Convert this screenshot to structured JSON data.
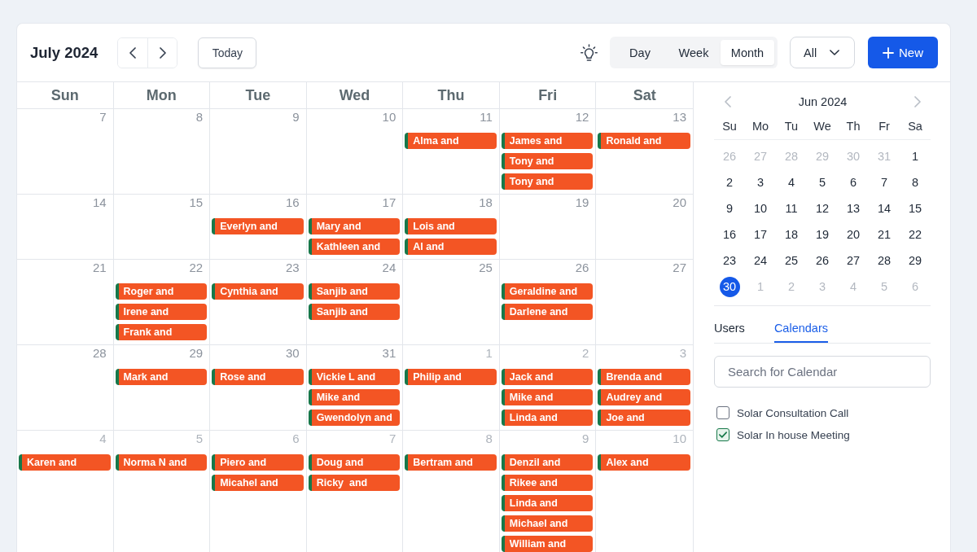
{
  "header": {
    "title": "July 2024",
    "today_button": "Today",
    "view_tabs": [
      {
        "label": "Day",
        "selected": false
      },
      {
        "label": "Week",
        "selected": false
      },
      {
        "label": "Month",
        "selected": true
      }
    ],
    "filter": {
      "value": "All"
    },
    "new_button": {
      "label": "New"
    }
  },
  "calendar": {
    "weekdays": [
      "Sun",
      "Mon",
      "Tue",
      "Wed",
      "Thu",
      "Fri",
      "Sat"
    ],
    "weeks": [
      {
        "days": [
          {
            "date": "7",
            "in_month": true
          },
          {
            "date": "8",
            "in_month": true
          },
          {
            "date": "9",
            "in_month": true
          },
          {
            "date": "10",
            "in_month": true
          },
          {
            "date": "11",
            "in_month": true,
            "events": [
              "Alma and"
            ]
          },
          {
            "date": "12",
            "in_month": true,
            "events": [
              "James and",
              "Tony and",
              "Tony and"
            ]
          },
          {
            "date": "13",
            "in_month": true,
            "events": [
              "Ronald and"
            ]
          }
        ]
      },
      {
        "days": [
          {
            "date": "14",
            "in_month": true
          },
          {
            "date": "15",
            "in_month": true
          },
          {
            "date": "16",
            "in_month": true,
            "events": [
              "Everlyn and"
            ]
          },
          {
            "date": "17",
            "in_month": true,
            "events": [
              "Mary and",
              "Kathleen and"
            ]
          },
          {
            "date": "18",
            "in_month": true,
            "events": [
              "Lois and",
              "Al and"
            ]
          },
          {
            "date": "19",
            "in_month": true
          },
          {
            "date": "20",
            "in_month": true
          }
        ]
      },
      {
        "days": [
          {
            "date": "21",
            "in_month": true
          },
          {
            "date": "22",
            "in_month": true,
            "events": [
              "Roger and",
              "Irene and",
              "Frank and"
            ]
          },
          {
            "date": "23",
            "in_month": true,
            "events": [
              "Cynthia and"
            ]
          },
          {
            "date": "24",
            "in_month": true,
            "events": [
              "Sanjib and",
              "Sanjib and"
            ]
          },
          {
            "date": "25",
            "in_month": true
          },
          {
            "date": "26",
            "in_month": true,
            "events": [
              "Geraldine and",
              "Darlene and"
            ]
          },
          {
            "date": "27",
            "in_month": true
          }
        ]
      },
      {
        "days": [
          {
            "date": "28",
            "in_month": true
          },
          {
            "date": "29",
            "in_month": true,
            "events": [
              "Mark and"
            ]
          },
          {
            "date": "30",
            "in_month": true,
            "events": [
              "Rose and"
            ]
          },
          {
            "date": "31",
            "in_month": true,
            "events": [
              "Vickie L and",
              "Mike and",
              "Gwendolyn and"
            ]
          },
          {
            "date": "1",
            "in_month": false,
            "events": [
              "Philip and"
            ]
          },
          {
            "date": "2",
            "in_month": false,
            "events": [
              "Jack and",
              "Mike and",
              "Linda and"
            ]
          },
          {
            "date": "3",
            "in_month": false,
            "events": [
              "Brenda and",
              "Audrey and",
              "Joe and"
            ]
          }
        ]
      },
      {
        "days": [
          {
            "date": "4",
            "in_month": false,
            "events": [
              "Karen and"
            ]
          },
          {
            "date": "5",
            "in_month": false,
            "events": [
              "Norma N and"
            ]
          },
          {
            "date": "6",
            "in_month": false,
            "events": [
              "Piero and",
              "Micahel and"
            ]
          },
          {
            "date": "7",
            "in_month": false,
            "events": [
              "Doug and",
              "Ricky  and"
            ]
          },
          {
            "date": "8",
            "in_month": false,
            "events": [
              "Bertram and"
            ]
          },
          {
            "date": "9",
            "in_month": false,
            "events": [
              "Denzil and",
              "Rikee and",
              "Linda and",
              "Michael and",
              "William and"
            ]
          },
          {
            "date": "10",
            "in_month": false,
            "events": [
              "Alex and"
            ]
          }
        ]
      }
    ]
  },
  "sidebar": {
    "mini_calendar": {
      "title": "Jun 2024",
      "weekdays": [
        "Su",
        "Mo",
        "Tu",
        "We",
        "Th",
        "Fr",
        "Sa"
      ],
      "weeks": [
        {
          "days": [
            {
              "date": "26",
              "in_month": false,
              "selected": false
            },
            {
              "date": "27",
              "in_month": false,
              "selected": false
            },
            {
              "date": "28",
              "in_month": false,
              "selected": false
            },
            {
              "date": "29",
              "in_month": false,
              "selected": false
            },
            {
              "date": "30",
              "in_month": false,
              "selected": false
            },
            {
              "date": "31",
              "in_month": false,
              "selected": false
            },
            {
              "date": "1",
              "in_month": true,
              "selected": false
            }
          ]
        },
        {
          "days": [
            {
              "date": "2",
              "in_month": true,
              "selected": false
            },
            {
              "date": "3",
              "in_month": true,
              "selected": false
            },
            {
              "date": "4",
              "in_month": true,
              "selected": false
            },
            {
              "date": "5",
              "in_month": true,
              "selected": false
            },
            {
              "date": "6",
              "in_month": true,
              "selected": false
            },
            {
              "date": "7",
              "in_month": true,
              "selected": false
            },
            {
              "date": "8",
              "in_month": true,
              "selected": false
            }
          ]
        },
        {
          "days": [
            {
              "date": "9",
              "in_month": true,
              "selected": false
            },
            {
              "date": "10",
              "in_month": true,
              "selected": false
            },
            {
              "date": "11",
              "in_month": true,
              "selected": false
            },
            {
              "date": "12",
              "in_month": true,
              "selected": false
            },
            {
              "date": "13",
              "in_month": true,
              "selected": false
            },
            {
              "date": "14",
              "in_month": true,
              "selected": false
            },
            {
              "date": "15",
              "in_month": true,
              "selected": false
            }
          ]
        },
        {
          "days": [
            {
              "date": "16",
              "in_month": true,
              "selected": false
            },
            {
              "date": "17",
              "in_month": true,
              "selected": false
            },
            {
              "date": "18",
              "in_month": true,
              "selected": false
            },
            {
              "date": "19",
              "in_month": true,
              "selected": false
            },
            {
              "date": "20",
              "in_month": true,
              "selected": false
            },
            {
              "date": "21",
              "in_month": true,
              "selected": false
            },
            {
              "date": "22",
              "in_month": true,
              "selected": false
            }
          ]
        },
        {
          "days": [
            {
              "date": "23",
              "in_month": true,
              "selected": false
            },
            {
              "date": "24",
              "in_month": true,
              "selected": false
            },
            {
              "date": "25",
              "in_month": true,
              "selected": false
            },
            {
              "date": "26",
              "in_month": true,
              "selected": false
            },
            {
              "date": "27",
              "in_month": true,
              "selected": false
            },
            {
              "date": "28",
              "in_month": true,
              "selected": false
            },
            {
              "date": "29",
              "in_month": true,
              "selected": false
            }
          ]
        },
        {
          "days": [
            {
              "date": "30",
              "in_month": true,
              "selected": true
            },
            {
              "date": "1",
              "in_month": false,
              "selected": false
            },
            {
              "date": "2",
              "in_month": false,
              "selected": false
            },
            {
              "date": "3",
              "in_month": false,
              "selected": false
            },
            {
              "date": "4",
              "in_month": false,
              "selected": false
            },
            {
              "date": "5",
              "in_month": false,
              "selected": false
            },
            {
              "date": "6",
              "in_month": false,
              "selected": false
            }
          ]
        }
      ]
    },
    "tabs": [
      {
        "label": "Users",
        "selected": false
      },
      {
        "label": "Calendars",
        "selected": true
      }
    ],
    "search": {
      "placeholder": "Search for Calendar"
    },
    "calendars": [
      {
        "label": "Solar Consultation Call",
        "checked": false
      },
      {
        "label": "Solar In house Meeting",
        "checked": true
      }
    ]
  }
}
